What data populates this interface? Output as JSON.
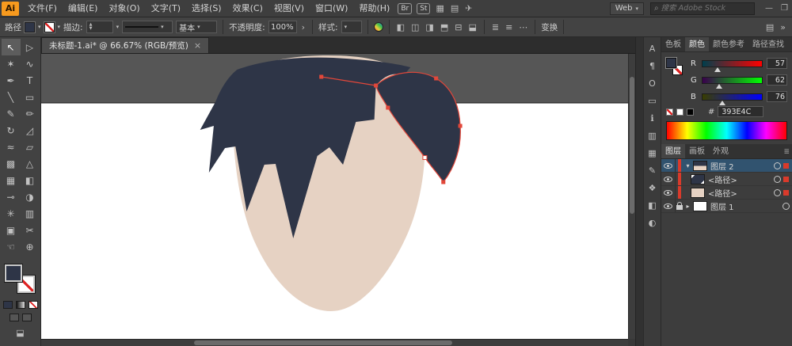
{
  "menu_bar": {
    "logo": "Ai",
    "items": [
      {
        "label": "文件(F)"
      },
      {
        "label": "编辑(E)"
      },
      {
        "label": "对象(O)"
      },
      {
        "label": "文字(T)"
      },
      {
        "label": "选择(S)"
      },
      {
        "label": "效果(C)"
      },
      {
        "label": "视图(V)"
      },
      {
        "label": "窗口(W)"
      },
      {
        "label": "帮助(H)"
      }
    ],
    "br_badge": "Br",
    "st_badge": "St",
    "icons": [
      {
        "name": "arrange-documents-icon",
        "glyph": "▦"
      },
      {
        "name": "workspace-layout-icon",
        "glyph": "▤"
      },
      {
        "name": "share-icon",
        "glyph": "✈"
      }
    ],
    "workspace_label": "Web",
    "workspace_caret": "▾",
    "search_placeholder": "搜索 Adobe Stock",
    "window_icons": [
      {
        "name": "minimize-icon",
        "glyph": "—"
      },
      {
        "name": "restore-icon",
        "glyph": "❐"
      }
    ]
  },
  "control_bar": {
    "context_label": "路径",
    "stroke_label": "描边:",
    "brush_label": "基本",
    "opacity_label": "不透明度:",
    "opacity_value": "100%",
    "opacity_chevron": "›",
    "style_label": "样式:",
    "align_icons": [
      {
        "name": "align-left-icon",
        "glyph": "◧"
      },
      {
        "name": "align-h-center-icon",
        "glyph": "◫"
      },
      {
        "name": "align-right-icon",
        "glyph": "◨"
      },
      {
        "name": "align-top-icon",
        "glyph": "⬒"
      },
      {
        "name": "align-v-center-icon",
        "glyph": "⊟"
      },
      {
        "name": "align-bottom-icon",
        "glyph": "⬓"
      }
    ],
    "distribute_icons": [
      {
        "name": "distribute-left-icon",
        "glyph": "≣"
      },
      {
        "name": "distribute-center-icon",
        "glyph": "≡"
      },
      {
        "name": "distribute-right-icon",
        "glyph": "⋯"
      }
    ],
    "transform_label": "变换",
    "right_icons": [
      {
        "name": "panel-menu-icon",
        "glyph": "▤"
      },
      {
        "name": "double-chevron-icon",
        "glyph": "»"
      }
    ]
  },
  "document": {
    "tab_title": "未标题-1.ai* @ 66.67% (RGB/预览)",
    "close_glyph": "×",
    "zoom": "66.67%"
  },
  "toolbar": {
    "tools": [
      {
        "name": "selection-tool",
        "glyph": "↖"
      },
      {
        "name": "direct-selection-tool",
        "glyph": "▷"
      },
      {
        "name": "magic-wand-tool",
        "glyph": "✶"
      },
      {
        "name": "lasso-tool",
        "glyph": "∿"
      },
      {
        "name": "pen-tool",
        "glyph": "✒"
      },
      {
        "name": "type-tool",
        "glyph": "T"
      },
      {
        "name": "line-segment-tool",
        "glyph": "╲"
      },
      {
        "name": "rectangle-tool",
        "glyph": "▭"
      },
      {
        "name": "paintbrush-tool",
        "glyph": "✎"
      },
      {
        "name": "pencil-tool",
        "glyph": "✏"
      },
      {
        "name": "rotate-tool",
        "glyph": "↻"
      },
      {
        "name": "scale-tool",
        "glyph": "◿"
      },
      {
        "name": "width-tool",
        "glyph": "≈"
      },
      {
        "name": "free-transform-tool",
        "glyph": "▱"
      },
      {
        "name": "shape-builder-tool",
        "glyph": "▩"
      },
      {
        "name": "perspective-grid-tool",
        "glyph": "△"
      },
      {
        "name": "mesh-tool",
        "glyph": "▦"
      },
      {
        "name": "gradient-tool",
        "glyph": "◧"
      },
      {
        "name": "eyedropper-tool",
        "glyph": "⊸"
      },
      {
        "name": "blend-tool",
        "glyph": "◑"
      },
      {
        "name": "symbol-sprayer-tool",
        "glyph": "✳"
      },
      {
        "name": "column-graph-tool",
        "glyph": "▥"
      },
      {
        "name": "artboard-tool",
        "glyph": "▣"
      },
      {
        "name": "slice-tool",
        "glyph": "✂"
      },
      {
        "name": "hand-tool",
        "glyph": "☜"
      },
      {
        "name": "zoom-tool",
        "glyph": "⊕"
      }
    ]
  },
  "panel_strip": {
    "icons": [
      {
        "name": "character-panel-icon",
        "glyph": "A"
      },
      {
        "name": "paragraph-panel-icon",
        "glyph": "¶"
      },
      {
        "name": "opentype-panel-icon",
        "glyph": "O"
      },
      {
        "name": "artboard-panel-icon",
        "glyph": "▭"
      },
      {
        "name": "info-panel-icon",
        "glyph": "ℹ"
      },
      {
        "name": "graph-panel-icon",
        "glyph": "▥"
      },
      {
        "name": "swatches-panel-icon",
        "glyph": "▦"
      },
      {
        "name": "brushes-panel-icon",
        "glyph": "✎"
      },
      {
        "name": "symbols-panel-icon",
        "glyph": "❖"
      },
      {
        "name": "gradient-panel-icon",
        "glyph": "◧"
      },
      {
        "name": "transparency-panel-icon",
        "glyph": "◐"
      }
    ]
  },
  "color_panel": {
    "tabs": [
      {
        "label": "色板"
      },
      {
        "label": "颜色"
      },
      {
        "label": "颜色参考"
      },
      {
        "label": "路径查找"
      }
    ],
    "active_tab": "颜色",
    "sliders": [
      {
        "label": "R",
        "value": "57"
      },
      {
        "label": "G",
        "value": "62"
      },
      {
        "label": "B",
        "value": "76"
      }
    ],
    "hex_prefix": "#",
    "hex_value": "393E4C"
  },
  "layers_panel": {
    "tabs": [
      {
        "label": "图层"
      },
      {
        "label": "画板"
      },
      {
        "label": "外观"
      }
    ],
    "active_tab": "图层",
    "rows": [
      {
        "label": "图层 2",
        "caret": "▾"
      },
      {
        "label": "<路径>",
        "caret": ""
      },
      {
        "label": "<路径>",
        "caret": ""
      },
      {
        "label": "图层 1",
        "caret": "▸"
      }
    ]
  },
  "artwork": {
    "pasteboard_color": "#565656",
    "artboard_color": "#ffffff",
    "skin_color": "#e6d2c3",
    "hair_color": "#2e3547",
    "selection_color": "#e2473a"
  }
}
